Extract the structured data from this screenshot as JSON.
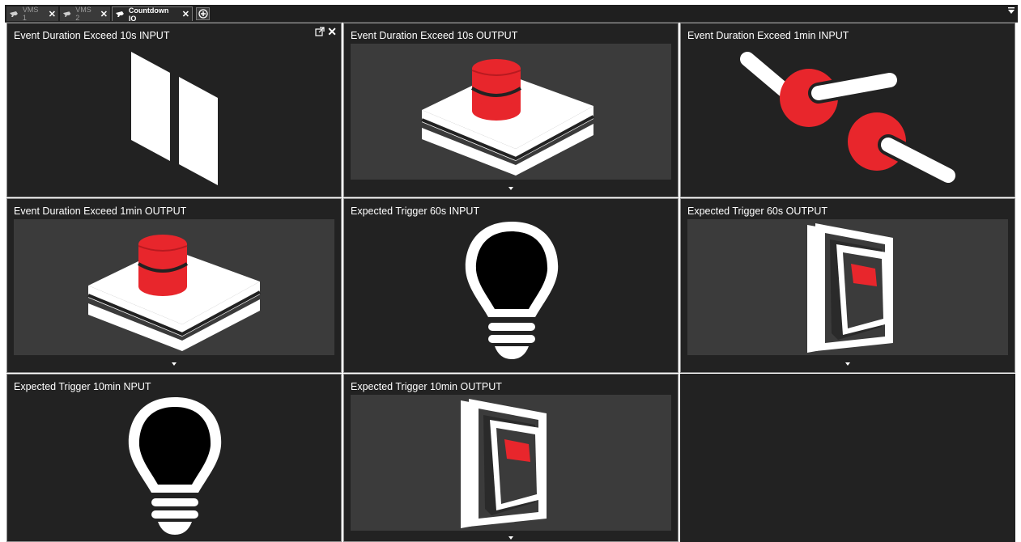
{
  "tabs": [
    {
      "label": "VMS 1",
      "active": false
    },
    {
      "label": "VMS 2",
      "active": false
    },
    {
      "label": "Countdown IO",
      "active": true
    }
  ],
  "tiles": [
    {
      "title": "Event Duration Exceed 10s INPUT",
      "icon": "pause-icon"
    },
    {
      "title": "Event Duration Exceed 10s OUTPUT",
      "icon": "push-button-icon"
    },
    {
      "title": "Event Duration Exceed 1min INPUT",
      "icon": "toggle-switch-icon"
    },
    {
      "title": "Event Duration Exceed 1min OUTPUT",
      "icon": "push-button-icon"
    },
    {
      "title": "Expected Trigger 60s INPUT",
      "icon": "light-bulb-icon"
    },
    {
      "title": "Expected Trigger 60s OUTPUT",
      "icon": "wall-switch-icon"
    },
    {
      "title": "Expected Trigger 10min NPUT",
      "icon": "light-bulb-icon"
    },
    {
      "title": "Expected Trigger 10min OUTPUT",
      "icon": "wall-switch-icon"
    }
  ],
  "colors": {
    "background": "#222222",
    "panel": "#3b3b3b",
    "accent_red": "#e8262c",
    "icon_white": "#ffffff"
  }
}
